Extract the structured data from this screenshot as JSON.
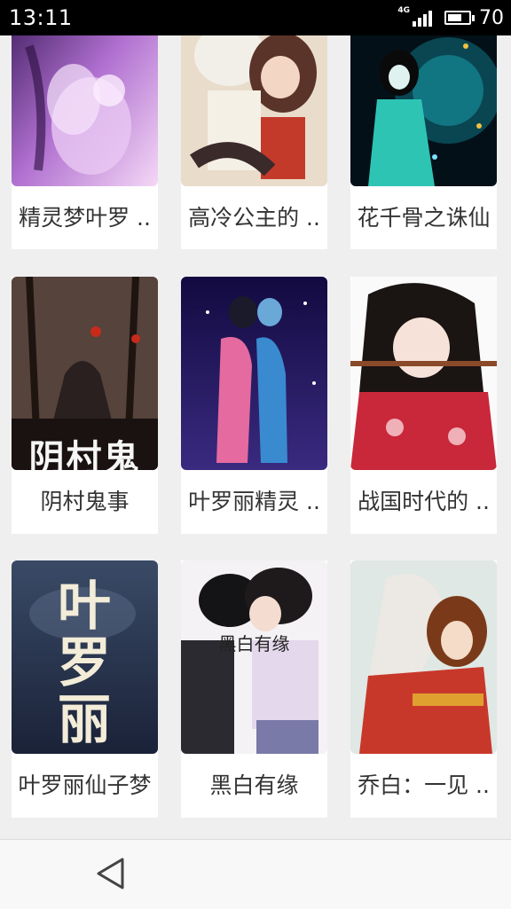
{
  "status_bar": {
    "time": "13:11",
    "network": "4G",
    "battery_percent": "70",
    "battery_level": 0.7
  },
  "books": [
    {
      "title": "精灵梦叶罗 ..",
      "cover_icon": "fairy-illustration-icon"
    },
    {
      "title": "高冷公主的 ..",
      "cover_icon": "couple-illustration-icon"
    },
    {
      "title": "花千骨之诛仙",
      "cover_icon": "umbrella-girl-illustration-icon"
    },
    {
      "title": "阴村鬼事",
      "cover_icon": "dark-forest-illustration-icon",
      "cover_text": "阴村鬼事"
    },
    {
      "title": "叶罗丽精灵 ..",
      "cover_icon": "dancing-couple-illustration-icon"
    },
    {
      "title": "战国时代的 ..",
      "cover_icon": "flute-girl-illustration-icon"
    },
    {
      "title": "叶罗丽仙子梦",
      "cover_icon": "calligraphy-cover-icon",
      "cover_text": "叶罗丽"
    },
    {
      "title": "黑白有缘",
      "cover_icon": "school-couple-illustration-icon",
      "cover_text": "黑白有缘"
    },
    {
      "title": "乔白：一见 ..",
      "cover_icon": "red-robe-couple-illustration-icon"
    }
  ],
  "nav_bar": {
    "back_icon": "back-triangle-icon"
  },
  "colors": {
    "status_bar": "#000000",
    "background": "#efefef",
    "card": "#ffffff"
  }
}
